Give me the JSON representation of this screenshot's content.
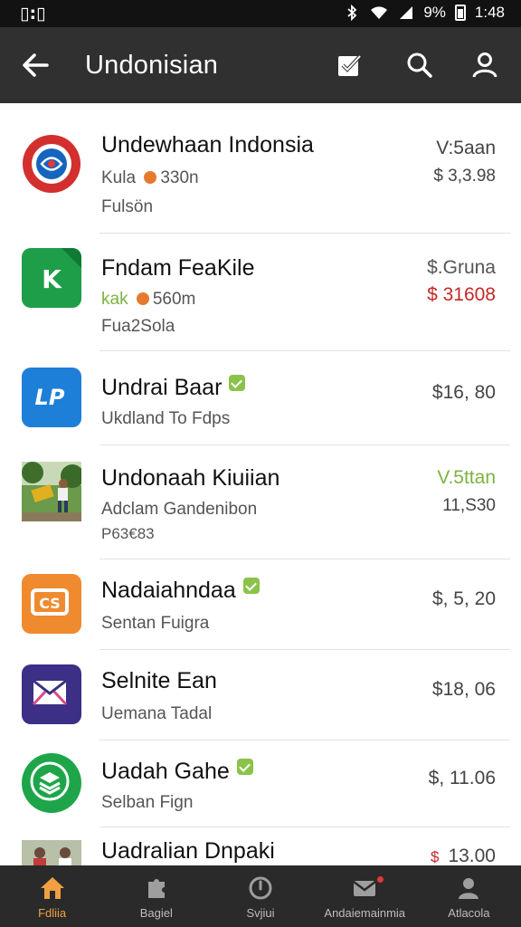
{
  "status_bar": {
    "left_text": "▯:▯",
    "right_text": "9%",
    "time": "1:48"
  },
  "app_bar": {
    "title": "Undonisian",
    "back_icon": "arrow-left-icon",
    "actions": [
      "checklist-icon",
      "search-icon",
      "account-icon"
    ]
  },
  "list": {
    "items": [
      {
        "title": "Undewhaan Indonsia",
        "sub1": "Kula",
        "sub1_extra": "330n",
        "sub2": "Fulsön",
        "price1": "V:5aan",
        "price2": "$ 3,3.98",
        "icon": "globe-logo-icon",
        "icon_color": "#d32f2f"
      },
      {
        "title": "Fndam FeaKile",
        "sub1": "kak",
        "sub1_extra": "560m",
        "sub2": "Fua2Sola",
        "price1": "$.Gruna",
        "price2": "$ 31608",
        "icon": "k-logo-icon",
        "icon_color": "#1e9e48"
      },
      {
        "title": "Undrai Baar",
        "sub1": "Ukdland To Fdps",
        "price1": "$16, 80",
        "icon": "lp-logo-icon",
        "icon_color": "#1e7fd8",
        "verified": true
      },
      {
        "title": "Undonaah Kiuiian",
        "sub1": "Adclam Gandenibon",
        "sub2": "P63€83",
        "price1": "V.5ttan",
        "price2": "11,S30",
        "icon": "playground-photo-icon"
      },
      {
        "title": "Nadaiahndaa",
        "sub1": "Sentan Fuigra",
        "price1": "$, 5, 20",
        "icon": "cs-logo-icon",
        "icon_color": "#f08a2e",
        "verified": true
      },
      {
        "title": "Selnite Ean",
        "sub1": "Uemana Tadal",
        "price1": "$18, 06",
        "icon": "mail-logo-icon",
        "icon_color": "#3b2f86"
      },
      {
        "title": "Uadah Gahe",
        "sub1": "Selban Fign",
        "price1": "$, 11.06",
        "icon": "layers-logo-icon",
        "icon_color": "#1ea54a",
        "verified": true
      },
      {
        "title": "Uadralian Dnpaki",
        "price1": "13.00",
        "price1_prefix": "$",
        "icon": "people-photo-icon"
      }
    ]
  },
  "bottom_nav": {
    "items": [
      {
        "label": "Fdliia",
        "icon": "home-icon",
        "active": true
      },
      {
        "label": "Bagiel",
        "icon": "puzzle-icon",
        "active": false
      },
      {
        "label": "Svjiui",
        "icon": "clock-icon",
        "active": false
      },
      {
        "label": "Andaiemainmia",
        "icon": "mail-icon",
        "active": false
      },
      {
        "label": "Atlacola",
        "icon": "person-icon",
        "active": false
      }
    ]
  },
  "colors": {
    "app_bar": "#303030",
    "status_bar": "#121212",
    "bottom_nav": "#2a2a2a",
    "accent_orange": "#f0a040",
    "price_green": "#7cb342",
    "price_red": "#c62828",
    "kak_green": "#7cb342"
  }
}
